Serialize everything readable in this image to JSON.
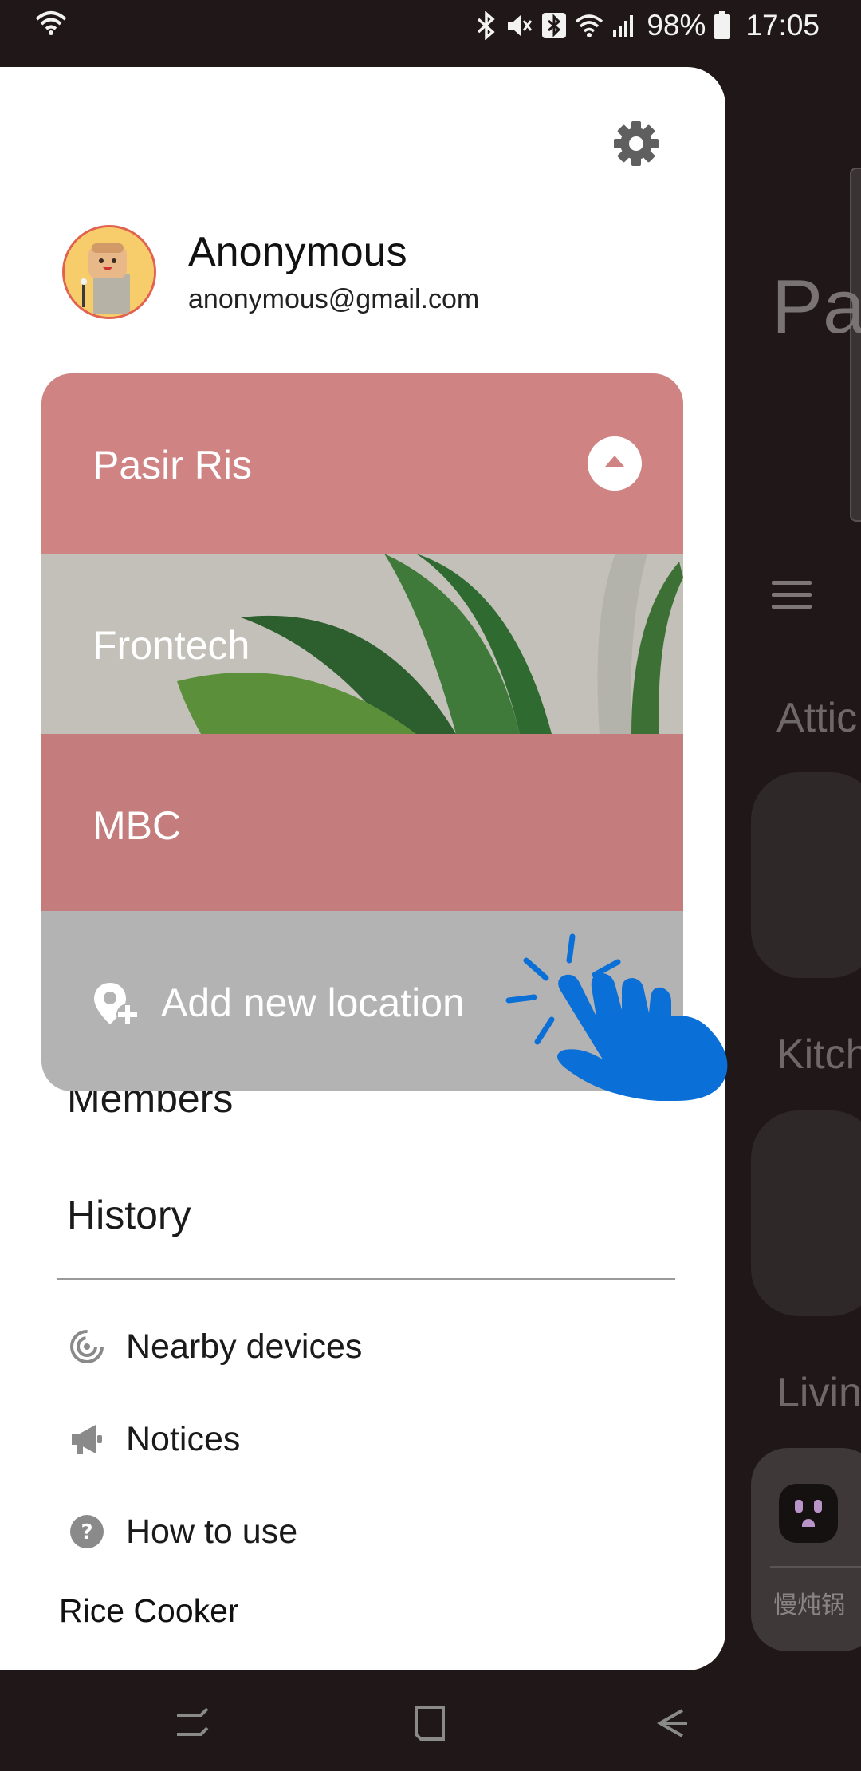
{
  "status_bar": {
    "battery": "98%",
    "time": "17:05"
  },
  "profile": {
    "name": "Anonymous",
    "email": "anonymous@gmail.com"
  },
  "locations": {
    "current": "Pasir Ris",
    "items": [
      {
        "label": "Frontech"
      },
      {
        "label": "MBC"
      }
    ],
    "add_label": "Add new location"
  },
  "menu": {
    "members": "Members",
    "history": "History"
  },
  "sub_menu": {
    "nearby": "Nearby devices",
    "notices": "Notices",
    "how_to": "How to use"
  },
  "extra": {
    "rice_cooker": "Rice Cooker"
  },
  "background": {
    "title_fragment": "Pa",
    "sections": [
      "Attic",
      "Kitch",
      "Livin"
    ],
    "device_name": "慢炖锅"
  },
  "colors": {
    "pasir_ris": "#cf8383",
    "mbc": "#c57c7c",
    "add_location": "#b3b3b3",
    "tap_hand": "#0a6fd6"
  }
}
